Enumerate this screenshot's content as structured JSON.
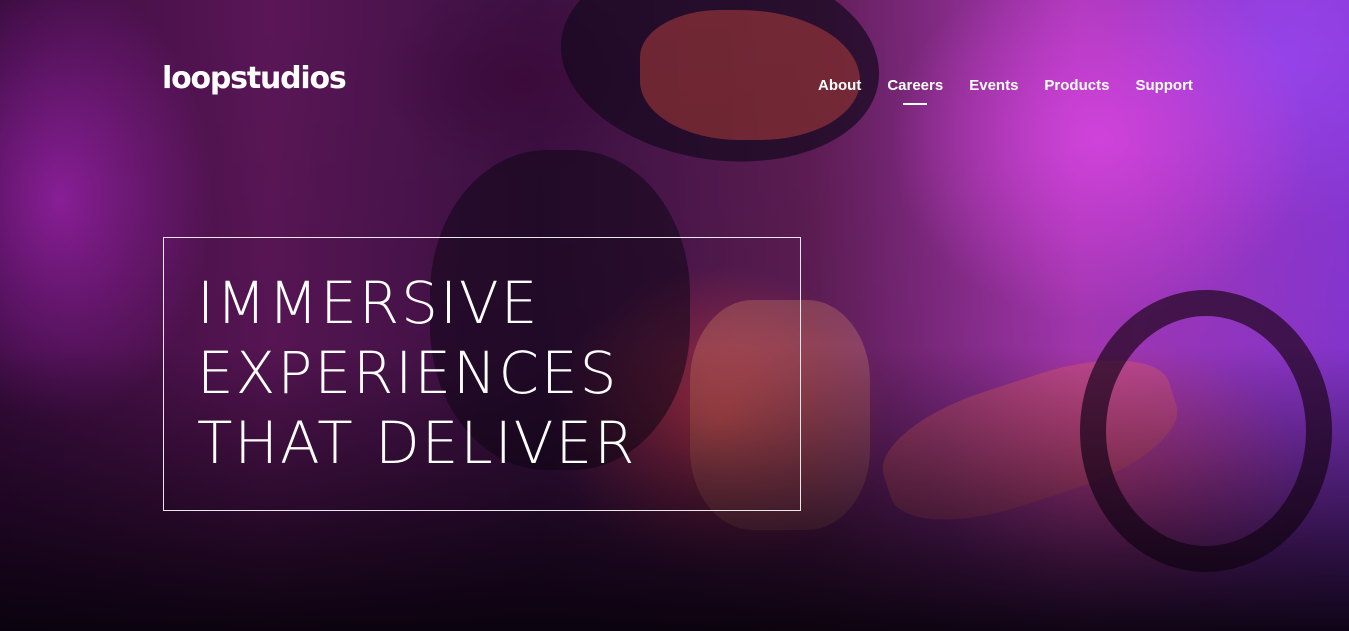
{
  "brand": {
    "logo_text": "loopstudios"
  },
  "nav": {
    "items": [
      {
        "label": "About"
      },
      {
        "label": "Careers"
      },
      {
        "label": "Events"
      },
      {
        "label": "Products"
      },
      {
        "label": "Support"
      }
    ],
    "active": "Careers"
  },
  "hero": {
    "headline_lines": [
      "IMMERSIVE",
      "EXPERIENCES",
      "THAT DELIVER"
    ]
  }
}
